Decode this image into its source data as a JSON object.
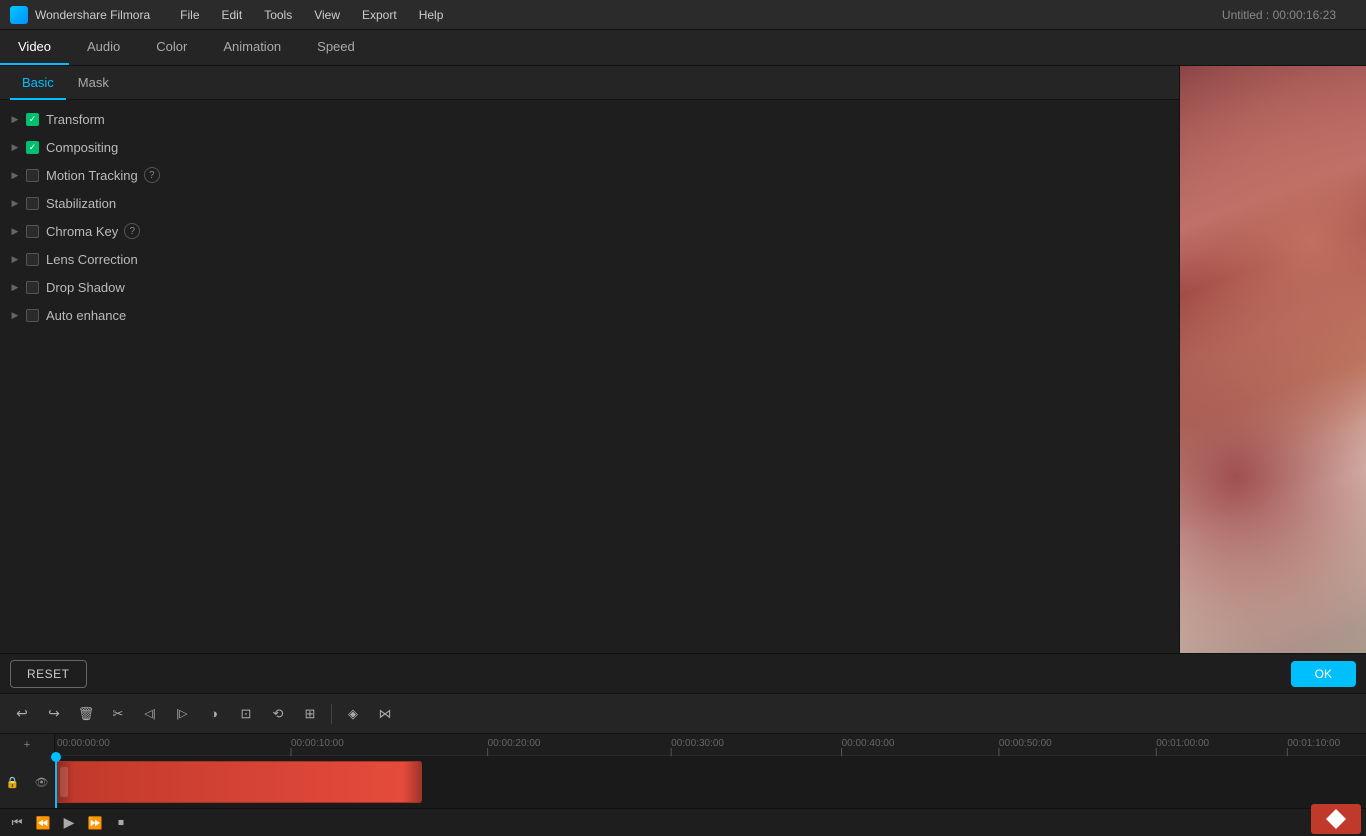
{
  "app": {
    "name": "Wondershare Filmora",
    "window_title": "Untitled : 00:00:16:23"
  },
  "menu": {
    "items": [
      "File",
      "Edit",
      "Tools",
      "View",
      "Export",
      "Help"
    ]
  },
  "main_tabs": [
    {
      "id": "video",
      "label": "Video",
      "active": true
    },
    {
      "id": "audio",
      "label": "Audio",
      "active": false
    },
    {
      "id": "color",
      "label": "Color",
      "active": false
    },
    {
      "id": "animation",
      "label": "Animation",
      "active": false
    },
    {
      "id": "speed",
      "label": "Speed",
      "active": false
    }
  ],
  "sub_tabs": [
    {
      "id": "basic",
      "label": "Basic",
      "active": true
    },
    {
      "id": "mask",
      "label": "Mask",
      "active": false
    }
  ],
  "properties": [
    {
      "id": "transform",
      "label": "Transform",
      "checked": true,
      "has_info": false
    },
    {
      "id": "compositing",
      "label": "Compositing",
      "checked": true,
      "has_info": false
    },
    {
      "id": "motion_tracking",
      "label": "Motion Tracking",
      "checked": false,
      "has_info": true
    },
    {
      "id": "stabilization",
      "label": "Stabilization",
      "checked": false,
      "has_info": false
    },
    {
      "id": "chroma_key",
      "label": "Chroma Key",
      "checked": false,
      "has_info": true
    },
    {
      "id": "lens_correction",
      "label": "Lens Correction",
      "checked": false,
      "has_info": false
    },
    {
      "id": "drop_shadow",
      "label": "Drop Shadow",
      "checked": false,
      "has_info": false
    },
    {
      "id": "auto_enhance",
      "label": "Auto enhance",
      "checked": false,
      "has_info": false
    }
  ],
  "buttons": {
    "reset": "RESET",
    "ok": "OK"
  },
  "toolbar_tools": [
    {
      "id": "undo",
      "icon": "↩",
      "label": "Undo"
    },
    {
      "id": "redo",
      "icon": "↪",
      "label": "Redo"
    },
    {
      "id": "delete",
      "icon": "🗑",
      "label": "Delete"
    },
    {
      "id": "cut",
      "icon": "✂",
      "label": "Cut"
    },
    {
      "id": "trim_start",
      "icon": "◁|",
      "label": "Trim Start"
    },
    {
      "id": "trim_end",
      "icon": "|▷",
      "label": "Trim End"
    },
    {
      "id": "speed",
      "icon": "◑",
      "label": "Speed"
    },
    {
      "id": "crop",
      "icon": "⊡",
      "label": "Crop"
    },
    {
      "id": "flip",
      "icon": "⟲",
      "label": "Flip"
    },
    {
      "id": "zoom_fit",
      "icon": "⊞",
      "label": "Zoom Fit"
    },
    {
      "id": "color_match",
      "icon": "◈",
      "label": "Color Match"
    },
    {
      "id": "audio_beat",
      "icon": "⋈",
      "label": "Audio Beat"
    }
  ],
  "timeline": {
    "time_markers": [
      "00:00:00:00",
      "00:00:10:00",
      "00:00:20:00",
      "00:00:30:00",
      "00:00:40:00",
      "00:00:50:00",
      "00:01:00:00",
      "00:01:10:00"
    ],
    "current_time": "00:00:00:00"
  },
  "transport": {
    "step_back": "⏮",
    "prev_frame": "⏪",
    "play": "▶",
    "next_frame": "⏩",
    "stop": "⏹"
  },
  "colors": {
    "accent": "#00bfff",
    "checked": "#00c070",
    "clip": "#c0392b",
    "bg": "#1e1e1e",
    "panel": "#252525"
  }
}
